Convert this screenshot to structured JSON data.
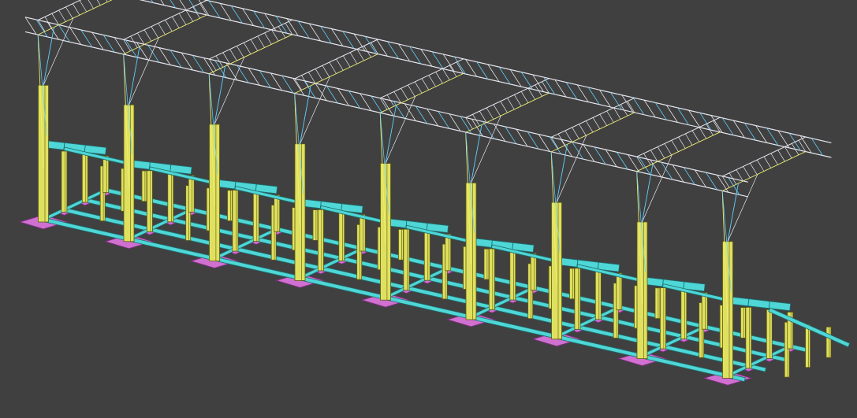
{
  "view": {
    "kind": "3D structural model viewport",
    "projection": "isometric",
    "background_color": "#404040"
  },
  "model": {
    "bays": 8,
    "main_column_lines": 9,
    "colors": {
      "column": "#E0E060",
      "column_edge": "#5C5C10",
      "beam": "#4FD6D6",
      "beam_edge": "#1E6E6E",
      "footing": "#D070D0",
      "footing_edge": "#7A2E7A",
      "truss_white": "#E6E6F0",
      "truss_yellow": "#F0F070",
      "truss_cyan": "#60D0FF"
    }
  }
}
